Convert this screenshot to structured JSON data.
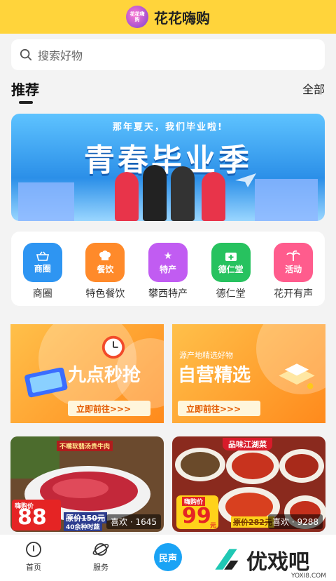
{
  "header": {
    "title": "花花嗨购",
    "logo_text": "花花嗨购"
  },
  "search": {
    "placeholder": "搜索好物"
  },
  "section": {
    "title": "推荐",
    "all_label": "全部"
  },
  "banner": {
    "subtitle": "那年夏天，我们毕业啦!",
    "title": "青春毕业季"
  },
  "categories": [
    {
      "icon_text": "商圈",
      "label": "商圈",
      "color": "#2e95f2",
      "icon": "basket-icon"
    },
    {
      "icon_text": "餐饮",
      "label": "特色餐饮",
      "color": "#ff8a2a",
      "icon": "chef-hat-icon"
    },
    {
      "icon_text": "特产",
      "label": "攀西特产",
      "color": "#c15cf2",
      "icon": "gift-star-icon"
    },
    {
      "icon_text": "德仁堂",
      "label": "德仁堂",
      "color": "#27c25f",
      "icon": "medical-kit-icon"
    },
    {
      "icon_text": "活动",
      "label": "花开有声",
      "color": "#ff5c8d",
      "icon": "palm-tree-icon"
    }
  ],
  "promos": [
    {
      "title": "九点秒抢",
      "button": "立即前往>>>"
    },
    {
      "subtitle": "源产地精选好物",
      "title": "自营精选",
      "button": "立即前往>>>"
    }
  ],
  "products": [
    {
      "badge": "不嘴软翡汤贵牛肉",
      "price_label": "嗨购价",
      "price": "88",
      "original": "原价150元",
      "note": "40余种时蔬",
      "likes": "喜欢 · 1645"
    },
    {
      "badge": "品味江湖菜",
      "price_label": "嗨购价",
      "price": "99",
      "price_unit": "元",
      "original": "原价282元",
      "likes": "喜欢 · 9288"
    }
  ],
  "tabs": [
    {
      "label": "首页",
      "icon": "home-icon"
    },
    {
      "label": "服务",
      "icon": "planet-icon"
    },
    {
      "label": "民声",
      "icon": "voice-icon"
    }
  ],
  "watermark": {
    "text": "优戏吧",
    "url": "YOXI8.COM"
  }
}
